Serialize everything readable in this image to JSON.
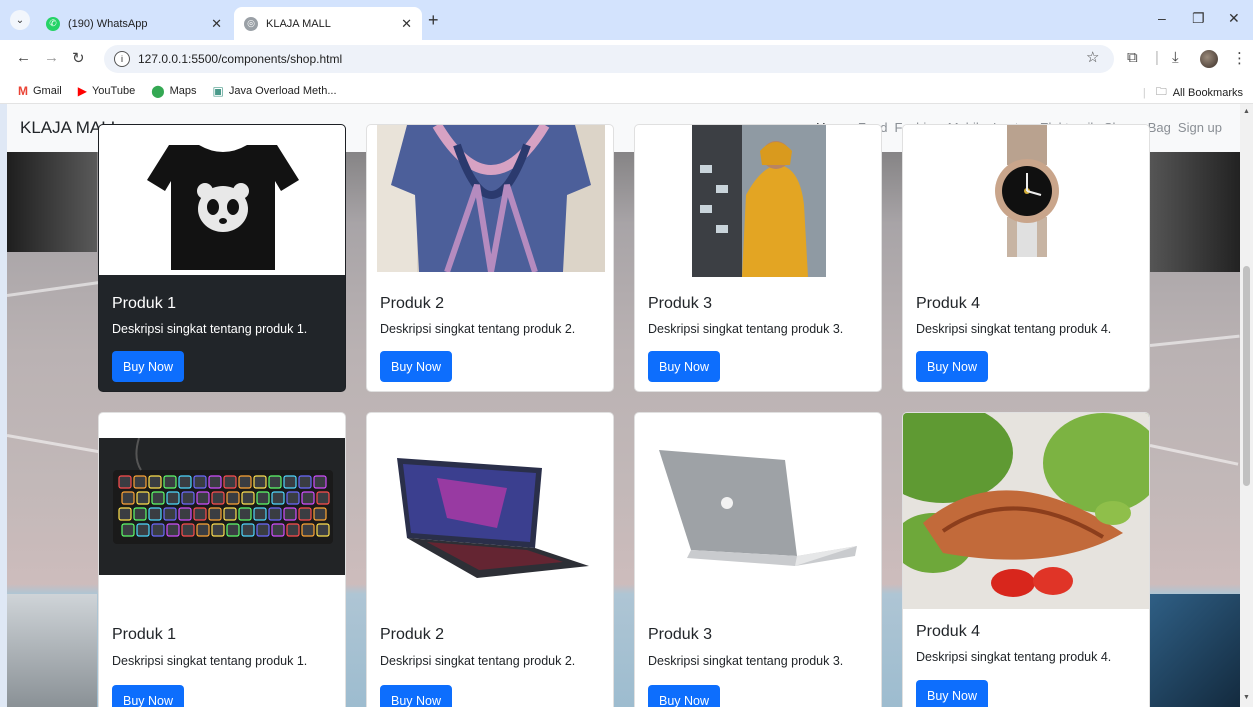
{
  "browser": {
    "tabs": [
      {
        "title": "(190) WhatsApp",
        "active": false
      },
      {
        "title": "KLAJA MALL",
        "active": true
      }
    ],
    "new_tab_symbol": "+",
    "url": "127.0.0.1:5500/components/shop.html",
    "bookmarks": [
      {
        "label": "Gmail",
        "icon": "gmail-icon"
      },
      {
        "label": "YouTube",
        "icon": "youtube-icon"
      },
      {
        "label": "Maps",
        "icon": "maps-icon"
      },
      {
        "label": "Java Overload Meth...",
        "icon": "page-icon"
      }
    ],
    "all_bookmarks": "All Bookmarks"
  },
  "site": {
    "brand": "KLAJA MALL",
    "nav": [
      "Home",
      "Food",
      "Fashion",
      "Mobile",
      "Laptop",
      "Elektronik",
      "Shoes",
      "Bag",
      "Sign up"
    ],
    "active_nav": "Home"
  },
  "products": {
    "row1": [
      {
        "title": "Produk 1",
        "text": "Deskripsi singkat tentang produk 1.",
        "button": "Buy Now",
        "image": "panda-tshirt"
      },
      {
        "title": "Produk 2",
        "text": "Deskripsi singkat tentang produk 2.",
        "button": "Buy Now",
        "image": "tie-dye-shirt"
      },
      {
        "title": "Produk 3",
        "text": "Deskripsi singkat tentang produk 3.",
        "button": "Buy Now",
        "image": "yellow-hoodie"
      },
      {
        "title": "Produk 4",
        "text": "Deskripsi singkat tentang produk 4.",
        "button": "Buy Now",
        "image": "wristwatch"
      }
    ],
    "row2": [
      {
        "title": "Produk 1",
        "text": "Deskripsi singkat tentang produk 1.",
        "button": "Buy Now",
        "image": "rgb-keyboard"
      },
      {
        "title": "Produk 2",
        "text": "Deskripsi singkat tentang produk 2.",
        "button": "Buy Now",
        "image": "gaming-laptop"
      },
      {
        "title": "Produk 3",
        "text": "Deskripsi singkat tentang produk 3.",
        "button": "Buy Now",
        "image": "silver-laptop"
      },
      {
        "title": "Produk 4",
        "text": "Deskripsi singkat tentang produk 4.",
        "button": "Buy Now",
        "image": "salmon-dish"
      }
    ]
  },
  "colors": {
    "primary_button": "#0d6efd",
    "dark_card": "#212529",
    "navbar": "#f8f9fa"
  }
}
